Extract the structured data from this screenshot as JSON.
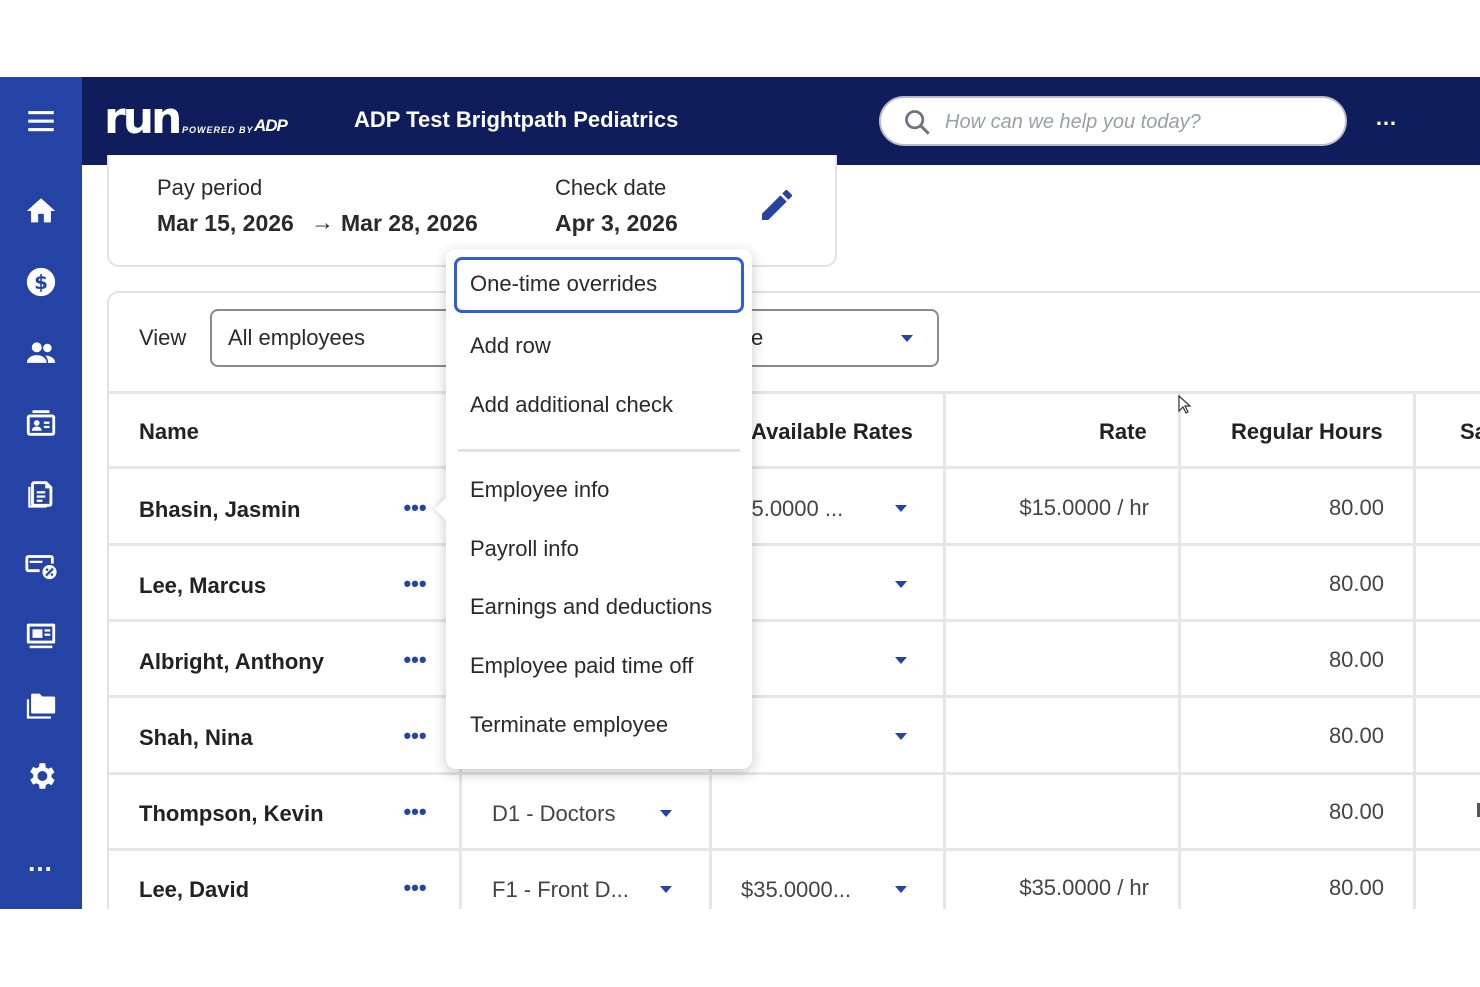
{
  "header": {
    "logo_text": "run",
    "logo_powered": "POWERED BY",
    "logo_brand": "ADP",
    "company": "ADP Test Brightpath Pediatrics",
    "search_placeholder": "How can we help you today?",
    "more_label": "…",
    "background": "#0f1d5c"
  },
  "sidebar": {
    "background": "#2443a4",
    "items": [
      {
        "icon": "menu-icon"
      },
      {
        "icon": "home-icon"
      },
      {
        "icon": "dollar-icon"
      },
      {
        "icon": "people-icon"
      },
      {
        "icon": "id-card-icon"
      },
      {
        "icon": "documents-icon"
      },
      {
        "icon": "benefits-icon"
      },
      {
        "icon": "presentation-icon"
      },
      {
        "icon": "folder-icon"
      },
      {
        "icon": "gear-icon"
      },
      {
        "icon": "more-icon",
        "label": "…"
      }
    ]
  },
  "pay_period": {
    "label": "Pay period",
    "start": "Mar 15, 2026",
    "arrow": "→",
    "end": "Mar 28, 2026",
    "check_label": "Check date",
    "check_date": "Apr 3, 2026"
  },
  "view": {
    "label": "View",
    "selected": "All employees",
    "second_select_partial": "e"
  },
  "table": {
    "columns": [
      "Name",
      "Available Rates",
      "Rate",
      "Regular Hours",
      "Sa"
    ],
    "rows": [
      {
        "name": "Bhasin, Jasmin",
        "department": "",
        "available_rate": "$15.0000 ...",
        "rate": "$15.0000 / hr",
        "regular_hours": "80.00"
      },
      {
        "name": "Lee, Marcus",
        "department": "",
        "available_rate": "",
        "rate": "",
        "regular_hours": "80.00"
      },
      {
        "name": "Albright, Anthony",
        "department": "",
        "available_rate": "",
        "rate": "",
        "regular_hours": "80.00"
      },
      {
        "name": "Shah, Nina",
        "department": "",
        "available_rate": "",
        "rate": "",
        "regular_hours": "80.00"
      },
      {
        "name": "Thompson, Kevin",
        "department": "D1 - Doctors",
        "available_rate": "",
        "rate": "",
        "regular_hours": "80.00"
      },
      {
        "name": "Lee, David",
        "department": "F1 - Front D...",
        "available_rate": "$35.0000...",
        "rate": "$35.0000 / hr",
        "regular_hours": "80.00"
      }
    ],
    "row_more_label": "•••"
  },
  "menu": {
    "items": [
      {
        "label": "One-time overrides",
        "active": true
      },
      {
        "label": "Add row"
      },
      {
        "label": "Add additional check"
      },
      {
        "label": "Employee info"
      },
      {
        "label": "Payroll info"
      },
      {
        "label": "Earnings and deductions"
      },
      {
        "label": "Employee paid time off"
      },
      {
        "label": "Terminate employee"
      }
    ]
  },
  "colors": {
    "accent": "#2443a4",
    "focus": "#2f5fd0"
  }
}
